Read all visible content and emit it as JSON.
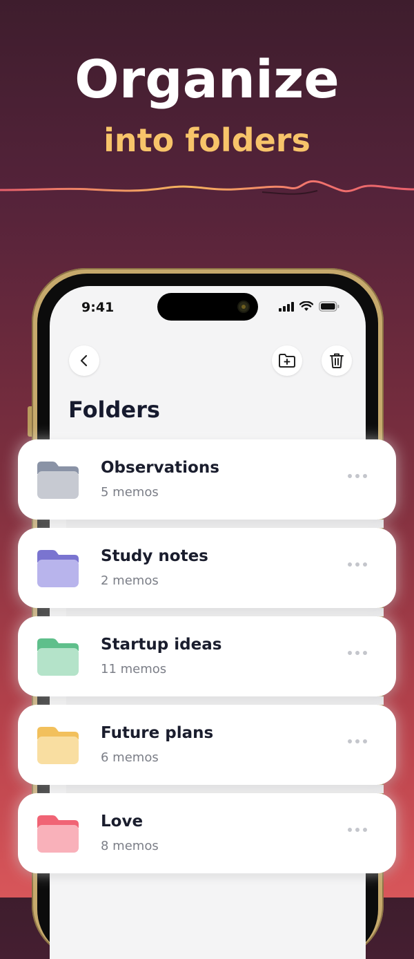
{
  "hero": {
    "headline": "Organize",
    "subline": "into folders"
  },
  "status_bar": {
    "time": "9:41"
  },
  "toolbar": {
    "back_icon": "chevron-left-icon",
    "new_folder_icon": "folder-plus-icon",
    "delete_icon": "trash-icon"
  },
  "page": {
    "title": "Folders"
  },
  "folders": [
    {
      "name": "Observations",
      "count": "5 memos",
      "color": "#8a93a6",
      "color_light": "#c7cad2"
    },
    {
      "name": "Study notes",
      "count": "2 memos",
      "color": "#7a74d0",
      "color_light": "#b8b4ec"
    },
    {
      "name": "Startup ideas",
      "count": "11 memos",
      "color": "#5fbf8b",
      "color_light": "#b4e3c9"
    },
    {
      "name": "Future plans",
      "count": "6 memos",
      "color": "#f2c05c",
      "color_light": "#f9dea1"
    },
    {
      "name": "Love",
      "count": "8 memos",
      "color": "#f06475",
      "color_light": "#f9b1ba"
    }
  ],
  "colors": {
    "accent_yellow": "#f7c46a",
    "title_dark": "#161a2e"
  }
}
